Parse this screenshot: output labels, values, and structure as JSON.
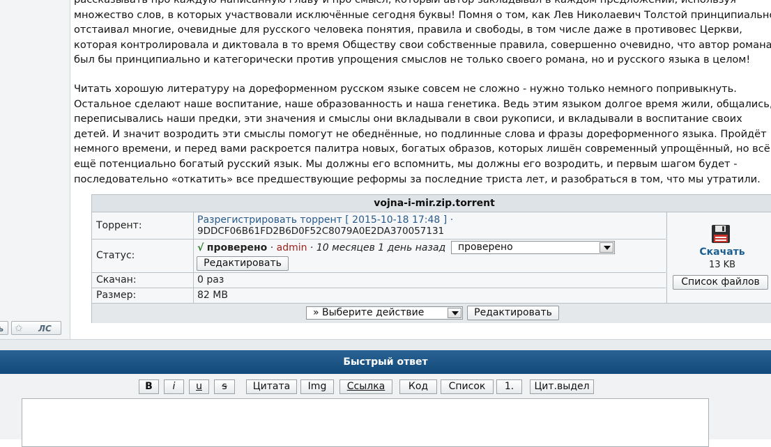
{
  "post": {
    "p1_lines": [
      "рассказывать про каждую написанную главу и про смысл, который автор закладывал в каждом предложении, используя",
      "множество слов, в которых участвовали исключённые сегодня буквы! Помня о том, как Лев Николаевич Толстой принципиально",
      "отстаивал многие, очевидные для русского человека понятия, правила и свободы, в том числе даже в противовес Церкви,",
      "которая контролировала и диктовала в то время Обществу свои собственные правила, совершенно очевидно, что автор романа",
      "был бы принципиально и категорически против упрощения смыслов не только своего романа, но и русского языка в целом!"
    ],
    "p2_lines": [
      "Читать хорошую литературу на дореформенном русском языке совсем не сложно - нужно только немного попривыкнуть.",
      "Остальное сделают наше воспитание, наше образованность и наша генетика. Ведь этим языком долгое время жили, общались,",
      "переписывались наши предки, эти значения и смыслы они вкладывали в свои рукописи, и вкладывали в воспитание своих",
      "детей. И значит возродить эти смыслы помогут не обеднённые, но подлинные слова и фразы дореформенного языка. Пройдёт",
      "немного времени, и перед вами раскроется палитра новых, богатых образов, которых лишён современный упрощённый, но всё",
      "ещё потенциально богатый русский язык. Мы должны его вспомнить, мы должны его возродить, и первым шагом будет -",
      "последовательно «откатить» все предшествующие реформы за последние триста лет, и разобраться в том, что мы утратили."
    ]
  },
  "sidebar": {
    "btn_left_label": "ь",
    "btn_ls_label": "ЛС"
  },
  "torrent": {
    "title": "vojna-i-mir.zip.torrent",
    "row_torrent_label": "Торрент:",
    "unregister_link": "Разрегистрировать торрент",
    "reg_date": "[ 2015-10-18 17:48 ] ·",
    "hash": "9DDCF06B61FD2B6D0F52C8079A0E2DA370057131",
    "row_status_label": "Статус:",
    "check_mark": "√",
    "status_text": "проверено",
    "sep1": "·",
    "status_user": "admin",
    "sep2": "·",
    "status_time": "10 месяцев 1 день назад",
    "status_select_value": "проверено",
    "edit_button": "Редактировать",
    "row_downloaded_label": "Скачан:",
    "downloaded_value": "0 раз",
    "row_size_label": "Размер:",
    "size_value": "82 MB",
    "download_link": "Скачать",
    "download_size": "13 KB",
    "file_list_button": "Список файлов",
    "action_select_value": "» Выберите действие",
    "action_edit_button": "Редактировать"
  },
  "quick_reply": {
    "title": "Быстрый ответ",
    "buttons": {
      "bold": "B",
      "italic": "i",
      "underline": "u",
      "strike": "s",
      "quote": "Цитата",
      "img": "Img",
      "link": "Ссылка",
      "code": "Код",
      "list": "Список",
      "numbered": "1.",
      "quote_selection": "Цит.выдел"
    }
  },
  "colors": {
    "link_blue": "#2a5a8a",
    "admin_red": "#a0221c",
    "ok_green": "#1f7a1f",
    "header_blue": "#1b5686"
  },
  "icons": {
    "download": "floppy-disk-icon",
    "pm": "star-icon"
  }
}
